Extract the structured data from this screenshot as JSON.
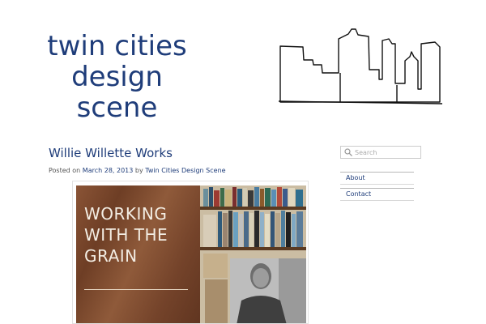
{
  "site": {
    "title_lines": [
      "twin cities",
      "design",
      "scene"
    ]
  },
  "post": {
    "title": "Willie Willette Works",
    "meta_prefix": "Posted on",
    "date": "March 28, 2013",
    "meta_by": "by",
    "author": "Twin Cities Design Scene",
    "image_text_lines": [
      "WORKING",
      "WITH THE",
      "GRAIN"
    ]
  },
  "sidebar": {
    "search_placeholder": "Search",
    "nav": [
      {
        "label": "About"
      },
      {
        "label": "Contact"
      }
    ]
  },
  "colors": {
    "title": "#1f3d7a",
    "link": "#1f3d7a",
    "meta_text": "#555555"
  }
}
